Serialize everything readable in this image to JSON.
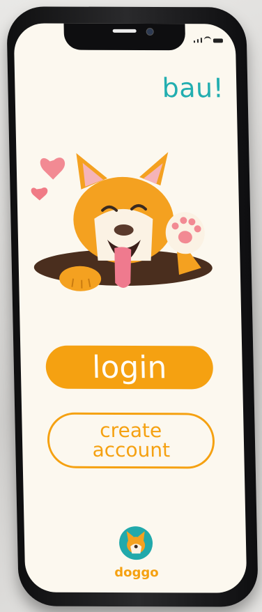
{
  "app": {
    "greeting": "bau!",
    "logo_text": "doggo"
  },
  "actions": {
    "login_label": "login",
    "create_label_line1": "create",
    "create_label_line2": "account"
  },
  "status_bar": {
    "signal_icon": "signal-icon",
    "wifi_icon": "wifi-icon",
    "battery_icon": "battery-icon"
  },
  "colors": {
    "background": "#fcf8ef",
    "accent": "#f5a111",
    "teal": "#22aeb0",
    "heart": "#f28a93"
  }
}
